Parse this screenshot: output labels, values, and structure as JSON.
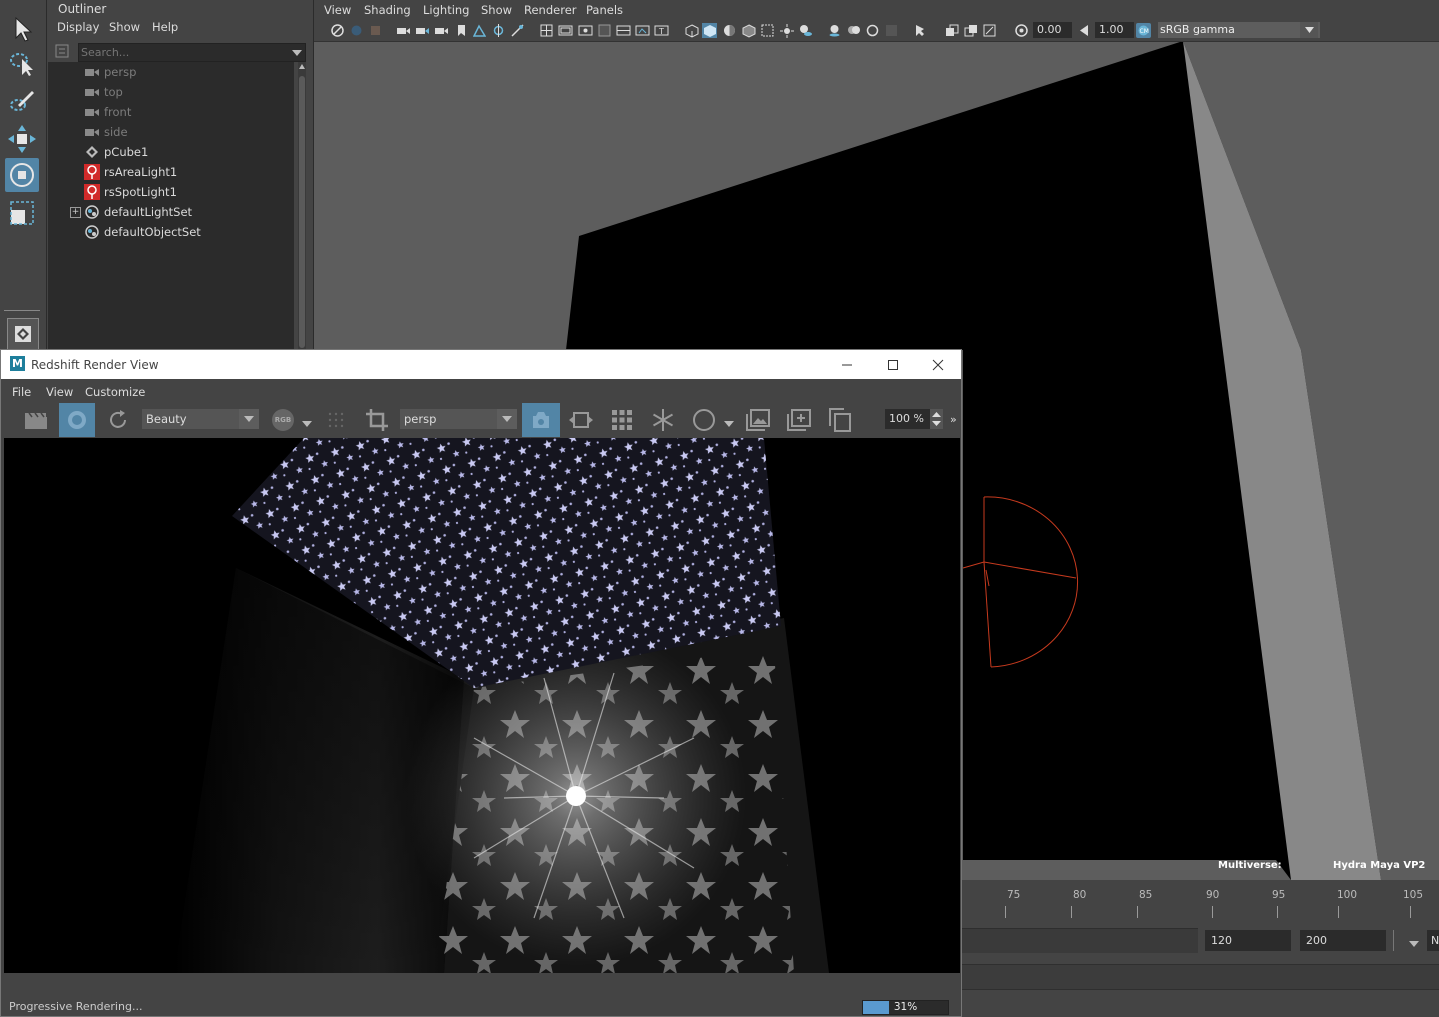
{
  "outliner": {
    "title": "Outliner",
    "menus": [
      "Display",
      "Show",
      "Help"
    ],
    "search_placeholder": "Search...",
    "items": [
      {
        "label": "persp",
        "icon": "camera-icon"
      },
      {
        "label": "top",
        "icon": "camera-icon"
      },
      {
        "label": "front",
        "icon": "camera-icon"
      },
      {
        "label": "side",
        "icon": "camera-icon"
      },
      {
        "label": "pCube1",
        "icon": "mesh-icon"
      },
      {
        "label": "rsAreaLight1",
        "icon": "light-bulb-icon"
      },
      {
        "label": "rsSpotLight1",
        "icon": "light-bulb-icon"
      },
      {
        "label": "defaultLightSet",
        "icon": "set-icon"
      },
      {
        "label": "defaultObjectSet",
        "icon": "set-icon"
      }
    ]
  },
  "viewport": {
    "menus": [
      "View",
      "Shading",
      "Lighting",
      "Show",
      "Renderer",
      "Panels"
    ],
    "exposure": "0.00",
    "gamma": "1.00",
    "color_space": "sRGB gamma",
    "hud_left": "Multiverse:",
    "hud_right": "Hydra Maya VP2"
  },
  "timeline": {
    "ticks": [
      "75",
      "80",
      "85",
      "90",
      "95",
      "100",
      "105"
    ],
    "end_value": "120",
    "range_end_value": "200",
    "cut_off_label": "N"
  },
  "render_view": {
    "title": "Redshift Render View",
    "menus": [
      "File",
      "View",
      "Customize"
    ],
    "aov": "Beauty",
    "channel": "RGB",
    "camera": "persp",
    "zoom": "100 %",
    "status": "Progressive Rendering...",
    "progress": 0.31,
    "progress_label": "31%"
  },
  "colors": {
    "accent": "#5285a6",
    "panel": "#444444",
    "progress": "#5a9ad0",
    "light_icon": "#d12a2a",
    "light_manip": "#c63a1e"
  }
}
